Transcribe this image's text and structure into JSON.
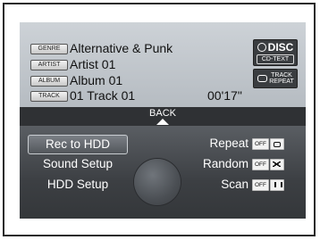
{
  "info": {
    "genre_tag": "GENRE",
    "genre": "Alternative & Punk",
    "artist_tag": "ARTIST",
    "artist": "Artist 01",
    "album_tag": "ALBUM",
    "album": "Album 01",
    "track_tag": "TRACK",
    "track": "01 Track 01",
    "time": "00'17\""
  },
  "badges": {
    "disc": "DISC",
    "cd_text": "CD-TEXT",
    "track_repeat": "TRACK REPEAT",
    "disc_icon": "disc-icon",
    "repeat_icon": "repeat-icon"
  },
  "back": {
    "label": "BACK",
    "icon": "up-arrow-icon"
  },
  "menu": {
    "rec_to_hdd": "Rec to HDD",
    "sound_setup": "Sound Setup",
    "hdd_setup": "HDD Setup"
  },
  "options": {
    "repeat": {
      "label": "Repeat",
      "state": "OFF",
      "icon": "repeat-icon"
    },
    "random": {
      "label": "Random",
      "state": "OFF",
      "icon": "shuffle-icon"
    },
    "scan": {
      "label": "Scan",
      "state": "OFF",
      "icon": "scan-icon"
    }
  },
  "colors": {
    "screen_top": "#cdd2d7",
    "back_bar": "#2f3134",
    "menu_bg": "#3c3f43",
    "text_dark": "#111111",
    "text_light": "#ffffff"
  }
}
